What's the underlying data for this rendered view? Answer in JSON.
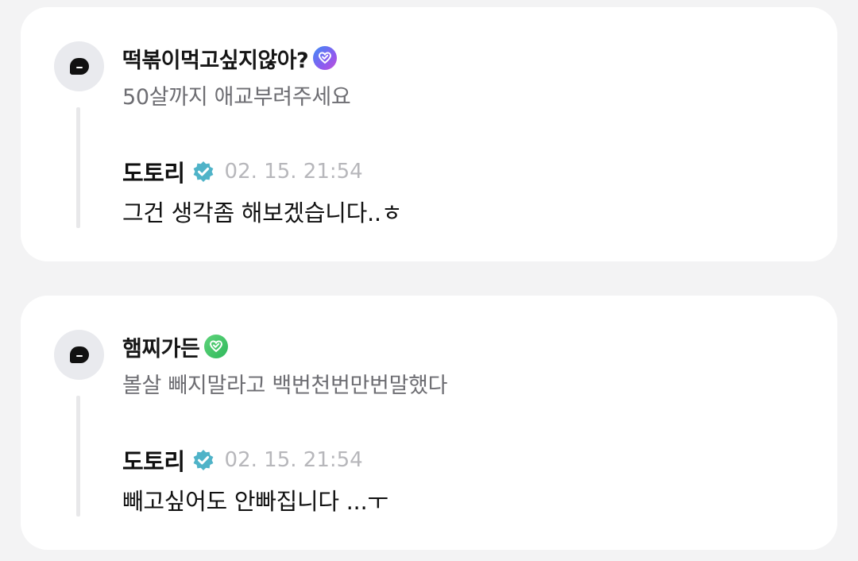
{
  "threads": [
    {
      "comment": {
        "nickname": "떡볶이먹고싶지않아?",
        "badge_color": "#8a5cf0",
        "badge_icon": "heart-level-badge-icon",
        "text": "50살까지 애교부려주세요"
      },
      "reply": {
        "author": "도토리",
        "verified_icon": "verified-check-icon",
        "time": "02. 15. 21:54",
        "text": "그건 생각좀 해보겠습니다..ㅎ"
      }
    },
    {
      "comment": {
        "nickname": "햄찌가든",
        "badge_color": "#3fc06a",
        "badge_icon": "heart-level-badge-icon",
        "text": "볼살 빼지말라고 백번천번만번말했다"
      },
      "reply": {
        "author": "도토리",
        "verified_icon": "verified-check-icon",
        "time": "02. 15. 21:54",
        "text": "빼고싶어도 안빠집니다 ...ㅜ"
      }
    }
  ],
  "colors": {
    "background": "#f3f3f4",
    "card": "#ffffff",
    "verified": "#4fb3c8"
  }
}
